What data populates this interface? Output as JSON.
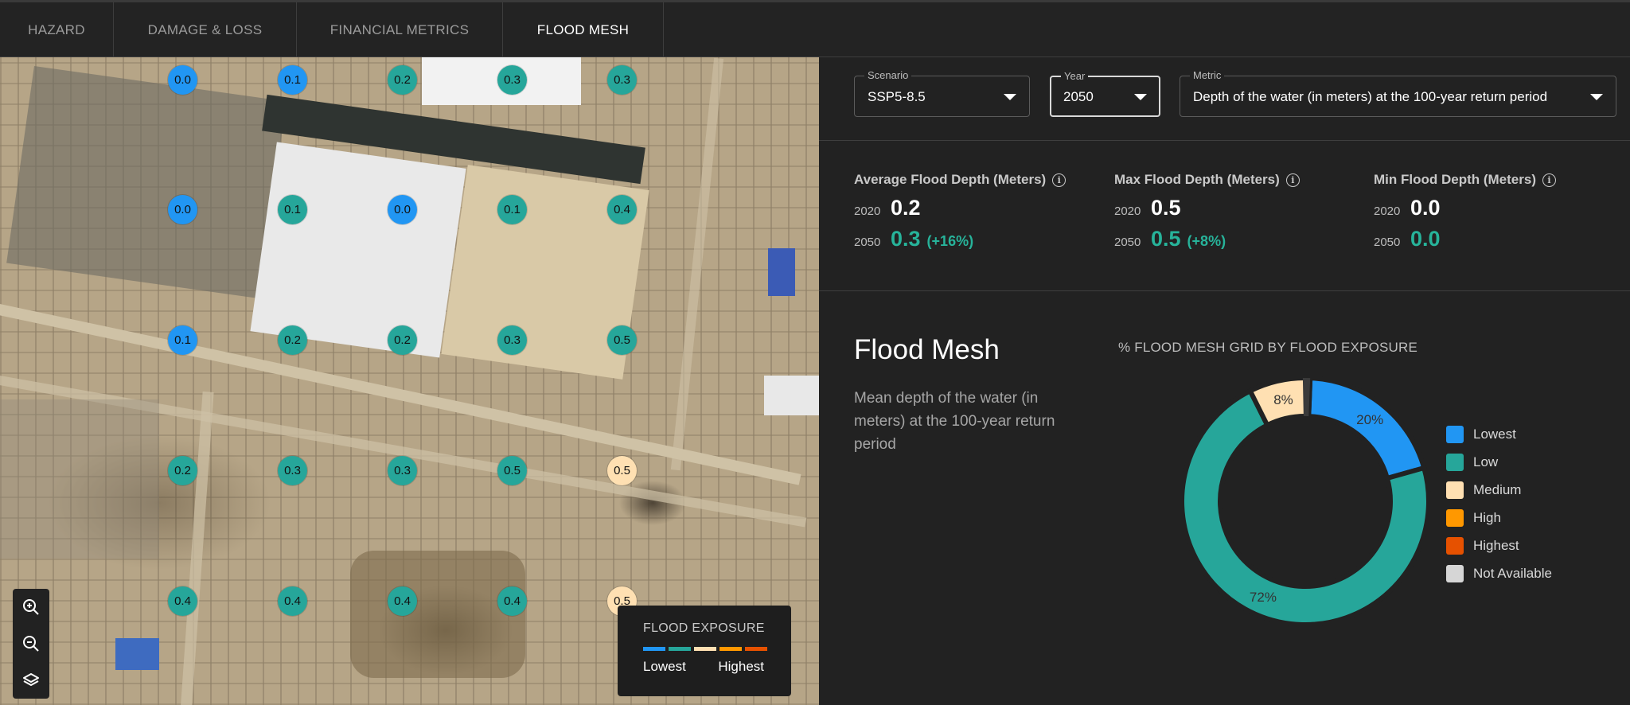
{
  "tabs": [
    {
      "label": "HAZARD",
      "active": false
    },
    {
      "label": "DAMAGE & LOSS",
      "active": false
    },
    {
      "label": "FINANCIAL METRICS",
      "active": false
    },
    {
      "label": "FLOOD MESH",
      "active": true
    }
  ],
  "colors": {
    "lowest": "#2196f3",
    "low": "#26a69a",
    "medium": "#ffe0b2",
    "high": "#ff9800",
    "highest": "#e65100",
    "not_available": "#d6d6d6",
    "accent_green": "#27b39a"
  },
  "map": {
    "grid_rows": [
      [
        {
          "v": "0.0",
          "c": "lowest"
        },
        {
          "v": "0.1",
          "c": "lowest"
        },
        {
          "v": "0.2",
          "c": "low"
        },
        {
          "v": "0.3",
          "c": "low"
        },
        {
          "v": "0.3",
          "c": "low"
        }
      ],
      [
        {
          "v": "0.0",
          "c": "lowest"
        },
        {
          "v": "0.1",
          "c": "low"
        },
        {
          "v": "0.0",
          "c": "lowest"
        },
        {
          "v": "0.1",
          "c": "low"
        },
        {
          "v": "0.4",
          "c": "low"
        }
      ],
      [
        {
          "v": "0.1",
          "c": "lowest"
        },
        {
          "v": "0.2",
          "c": "low"
        },
        {
          "v": "0.2",
          "c": "low"
        },
        {
          "v": "0.3",
          "c": "low"
        },
        {
          "v": "0.5",
          "c": "low"
        }
      ],
      [
        {
          "v": "0.2",
          "c": "low"
        },
        {
          "v": "0.3",
          "c": "low"
        },
        {
          "v": "0.3",
          "c": "low"
        },
        {
          "v": "0.5",
          "c": "low"
        },
        {
          "v": "0.5",
          "c": "medium"
        }
      ],
      [
        {
          "v": "0.4",
          "c": "low"
        },
        {
          "v": "0.4",
          "c": "low"
        },
        {
          "v": "0.4",
          "c": "low"
        },
        {
          "v": "0.4",
          "c": "low"
        },
        {
          "v": "0.5",
          "c": "medium"
        }
      ]
    ],
    "controls": [
      {
        "name": "zoom-in",
        "icon": "zoom-in-icon"
      },
      {
        "name": "zoom-out",
        "icon": "zoom-out-icon"
      },
      {
        "name": "layers",
        "icon": "layers-icon"
      }
    ],
    "legend": {
      "title": "FLOOD EXPOSURE",
      "low_label": "Lowest",
      "high_label": "Highest"
    }
  },
  "filters": {
    "scenario": {
      "label": "Scenario",
      "value": "SSP5-8.5"
    },
    "year": {
      "label": "Year",
      "value": "2050"
    },
    "metric": {
      "label": "Metric",
      "value": "Depth of the water (in meters) at the 100-year return period"
    }
  },
  "stats": [
    {
      "title": "Average Flood Depth (Meters)",
      "year1": "2020",
      "value1": "0.2",
      "year2": "2050",
      "value2": "0.3",
      "change": "(+16%)"
    },
    {
      "title": "Max Flood Depth (Meters)",
      "year1": "2020",
      "value1": "0.5",
      "year2": "2050",
      "value2": "0.5",
      "change": "(+8%)"
    },
    {
      "title": "Min Flood Depth (Meters)",
      "year1": "2020",
      "value1": "0.0",
      "year2": "2050",
      "value2": "0.0",
      "change": ""
    }
  ],
  "flood_mesh": {
    "title": "Flood Mesh",
    "description": "Mean depth of the water (in meters) at the 100-year return period"
  },
  "chart_data": {
    "type": "pie",
    "title": "% FLOOD MESH GRID BY FLOOD EXPOSURE",
    "donut": true,
    "categories": [
      "Lowest",
      "Low",
      "Medium",
      "High",
      "Highest",
      "Not Available"
    ],
    "values": [
      20,
      72,
      8,
      0,
      0,
      0
    ],
    "labels": [
      "20%",
      "72%",
      "8%",
      "",
      "",
      ""
    ],
    "colors": [
      "#2196f3",
      "#26a69a",
      "#ffe0b2",
      "#ff9800",
      "#e65100",
      "#d6d6d6"
    ],
    "legend_position": "right"
  }
}
